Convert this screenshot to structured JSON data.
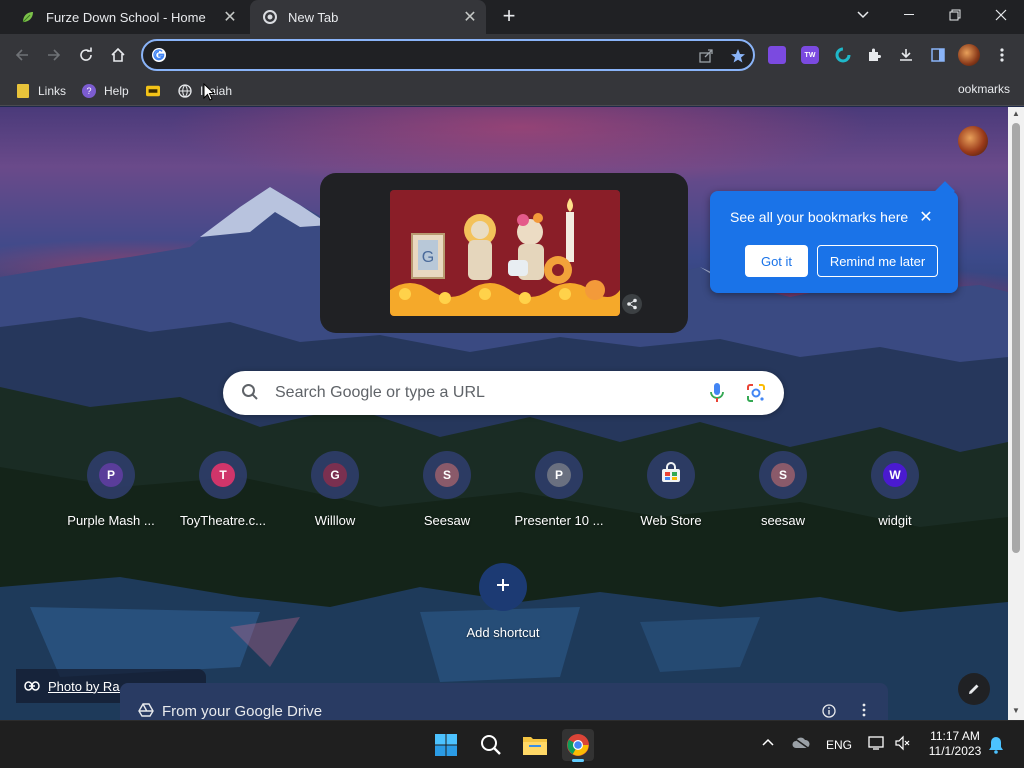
{
  "tabs": [
    {
      "title": "Furze Down School - Home",
      "icon": "leaf-favicon"
    },
    {
      "title": "New Tab",
      "icon": "chrome-favicon",
      "active": true
    }
  ],
  "window_controls": {
    "dropdown": "tab-search",
    "minimize": "minimize",
    "restore": "restore",
    "close": "close"
  },
  "omnibox": {
    "value": "",
    "placeholder": ""
  },
  "bookmarks": [
    {
      "label": "Links",
      "icon": "folder-icon"
    },
    {
      "label": "Help",
      "icon": "help-favicon"
    },
    {
      "label": "",
      "icon": "yellow-bookmark-icon"
    },
    {
      "label": "Isaiah",
      "icon": "globe-icon"
    }
  ],
  "bookmarks_overflow": "ookmarks",
  "bookmark_popup": {
    "message": "See all your bookmarks here",
    "got_it": "Got it",
    "remind_later": "Remind me later"
  },
  "search": {
    "placeholder": "Search Google or type a URL"
  },
  "shortcuts": [
    {
      "letter": "P",
      "label": "Purple Mash ...",
      "color": "#5a3d9a"
    },
    {
      "letter": "T",
      "label": "ToyTheatre.c...",
      "color": "#d0356a"
    },
    {
      "letter": "G",
      "label": "Willlow",
      "color": "#7a3050"
    },
    {
      "letter": "S",
      "label": "Seesaw",
      "color": "#8a5a6a"
    },
    {
      "letter": "P",
      "label": "Presenter 10 ...",
      "color": "#6a7080"
    },
    {
      "letter": "",
      "label": "Web Store",
      "color": "#ffffff"
    },
    {
      "letter": "S",
      "label": "seesaw",
      "color": "#8a5a6a"
    },
    {
      "letter": "W",
      "label": "widgit",
      "color": "#4a1ad0"
    }
  ],
  "add_shortcut": {
    "label": "Add shortcut"
  },
  "photo_credit": {
    "text": "Photo by Ra..."
  },
  "drive_card": {
    "title": "From your Google Drive"
  },
  "taskbar": {
    "language": "ENG",
    "time": "11:17 AM",
    "date": "11/1/2023"
  },
  "colors": {
    "accent": "#1a73e8",
    "omnibox_focus": "#8ab4f8",
    "tab_bar": "#202124",
    "toolbar": "#35363a"
  }
}
